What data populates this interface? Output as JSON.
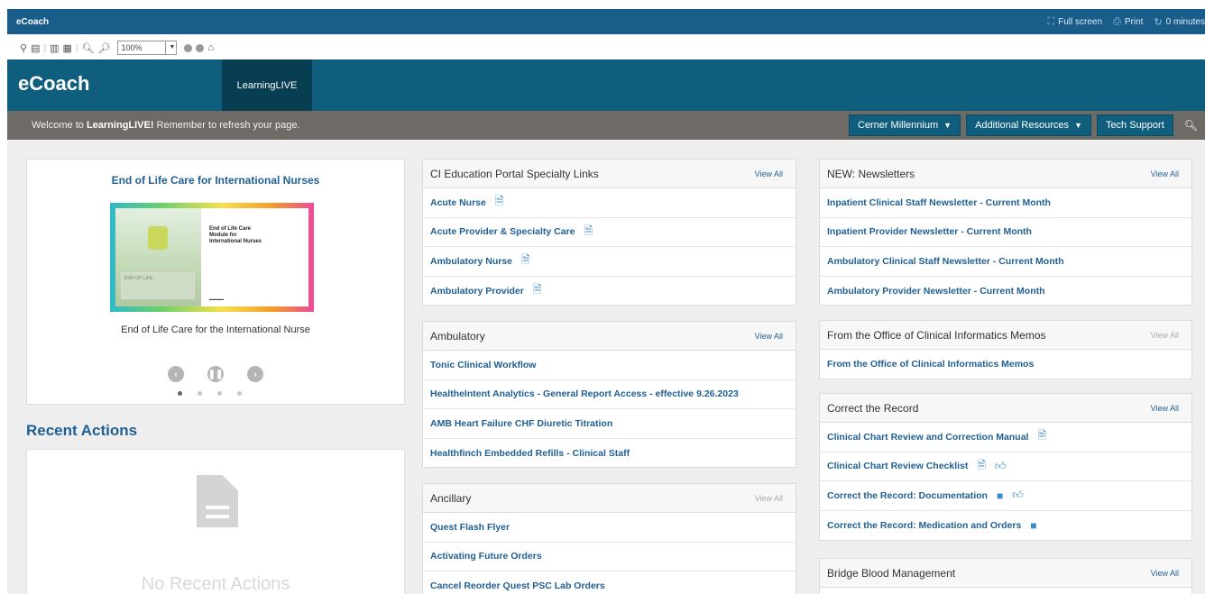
{
  "window": {
    "title": "eCoach",
    "fullscreen_label": "Full screen",
    "print_label": "Print",
    "timer_label": "0 minutes"
  },
  "toolbar": {
    "zoom_value": "100%"
  },
  "header": {
    "brand": "eCoach",
    "nav_tab": "LearningLIVE"
  },
  "subbar": {
    "welcome_prefix": "Welcome to ",
    "welcome_bold": "LearningLIVE!",
    "welcome_suffix": " Remember to refresh your page.",
    "menu1": "Cerner Millennium",
    "menu2": "Additional Resources",
    "menu3": "Tech Support"
  },
  "carousel": {
    "title": "End of Life Care for International Nurses",
    "thumb_text": "End of Life Care Module for International Nurses",
    "thumb_panel": "END-OF-LIFE",
    "caption": "End of Life Care for the International Nurse",
    "slides": 4,
    "active_slide": 1
  },
  "recent": {
    "title": "Recent Actions",
    "empty": "No Recent Actions"
  },
  "panels": [
    {
      "title": "CI Education Portal Specialty Links",
      "view_all": "View All",
      "view_all_dim": false,
      "items": [
        {
          "label": "Acute Nurse",
          "icons": [
            "document-icon"
          ]
        },
        {
          "label": "Acute Provider & Specialty Care",
          "icons": [
            "document-icon"
          ]
        },
        {
          "label": "Ambulatory Nurse",
          "icons": [
            "document-icon"
          ]
        },
        {
          "label": "Ambulatory Provider",
          "icons": [
            "document-icon"
          ]
        }
      ]
    },
    {
      "title": "Ambulatory",
      "view_all": "View All",
      "view_all_dim": false,
      "items": [
        {
          "label": "Tonic Clinical Workflow",
          "icons": []
        },
        {
          "label": "HealtheIntent Analytics - General Report Access - effective 9.26.2023",
          "icons": []
        },
        {
          "label": "AMB Heart Failure CHF Diuretic Titration",
          "icons": []
        },
        {
          "label": "Healthfinch Embedded Refills - Clinical Staff",
          "icons": []
        }
      ]
    },
    {
      "title": "Ancillary",
      "view_all": "View All",
      "view_all_dim": true,
      "items": [
        {
          "label": "Quest Flash Flyer",
          "icons": []
        },
        {
          "label": "Activating Future Orders",
          "icons": []
        },
        {
          "label": "Cancel Reorder Quest PSC Lab Orders",
          "icons": []
        }
      ]
    },
    {
      "title": "NEW: Newsletters",
      "view_all": "View All",
      "view_all_dim": false,
      "items": [
        {
          "label": "Inpatient Clinical Staff Newsletter - Current Month",
          "icons": []
        },
        {
          "label": "Inpatient Provider Newsletter - Current Month",
          "icons": []
        },
        {
          "label": "Ambulatory Clinical Staff Newsletter - Current Month",
          "icons": []
        },
        {
          "label": "Ambulatory Provider Newsletter - Current Month",
          "icons": []
        }
      ]
    },
    {
      "title": "From the Office of Clinical Informatics Memos",
      "view_all": "View All",
      "view_all_dim": true,
      "items": [
        {
          "label": "From the Office of Clinical Informatics Memos",
          "icons": []
        }
      ]
    },
    {
      "title": "Correct the Record",
      "view_all": "View All",
      "view_all_dim": false,
      "items": [
        {
          "label": "Clinical Chart Review and Correction Manual",
          "icons": [
            "document-icon"
          ]
        },
        {
          "label": "Clinical Chart Review Checklist",
          "icons": [
            "document-icon",
            "thumbs-up-icon"
          ]
        },
        {
          "label": "Correct the Record: Documentation",
          "icons": [
            "video-icon",
            "thumbs-up-icon"
          ]
        },
        {
          "label": "Correct the Record: Medication and Orders",
          "icons": [
            "video-icon"
          ]
        }
      ]
    },
    {
      "title": "Bridge Blood Management",
      "view_all": "View All",
      "view_all_dim": false,
      "items": []
    }
  ]
}
